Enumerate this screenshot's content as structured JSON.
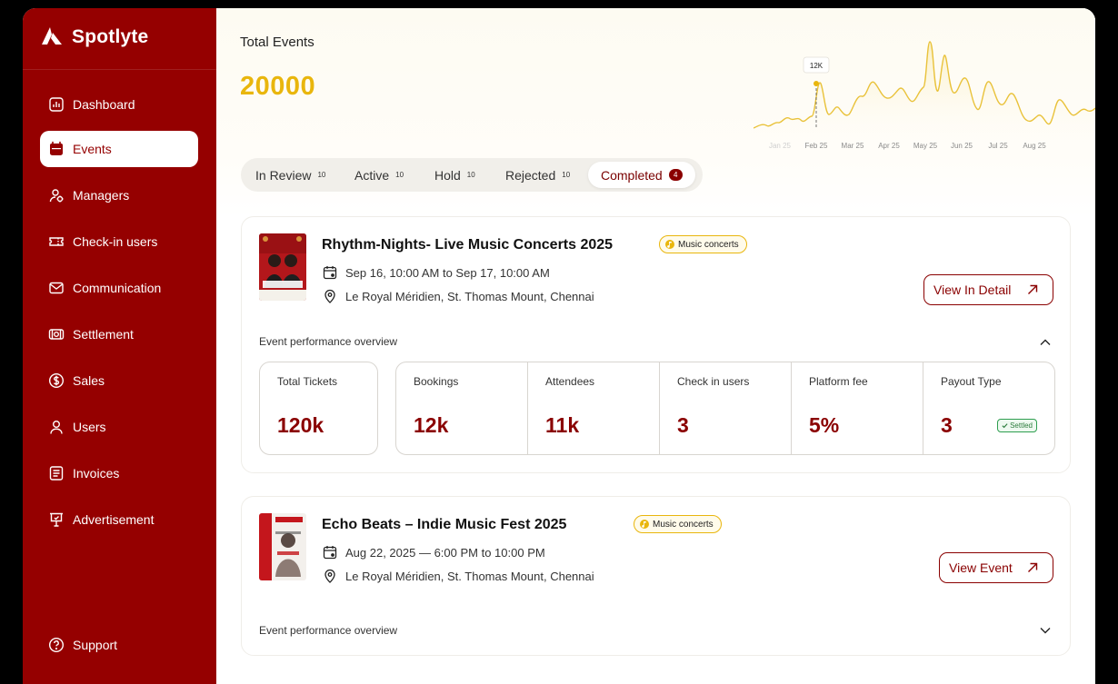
{
  "brand": {
    "name": "Spotlyte"
  },
  "sidebar": {
    "items": [
      {
        "label": "Dashboard",
        "icon": "chart-icon"
      },
      {
        "label": "Events",
        "icon": "calendar-icon",
        "active": true
      },
      {
        "label": "Managers",
        "icon": "managers-icon"
      },
      {
        "label": "Check-in users",
        "icon": "ticket-icon"
      },
      {
        "label": "Communication",
        "icon": "mail-icon"
      },
      {
        "label": "Settlement",
        "icon": "money-icon"
      },
      {
        "label": "Sales",
        "icon": "dollar-icon"
      },
      {
        "label": "Users",
        "icon": "user-icon"
      },
      {
        "label": "Invoices",
        "icon": "invoice-icon"
      },
      {
        "label": "Advertisement",
        "icon": "billboard-icon"
      }
    ],
    "support": "Support"
  },
  "summary": {
    "label": "Total Events",
    "value": "20000",
    "chart_tooltip": "12K",
    "months": [
      "Jan 25",
      "Feb 25",
      "Mar 25",
      "Apr 25",
      "May 25",
      "Jun 25",
      "Jul 25",
      "Aug 25"
    ]
  },
  "tabs": [
    {
      "label": "In Review",
      "count": "10"
    },
    {
      "label": "Active",
      "count": "10"
    },
    {
      "label": "Hold",
      "count": "10"
    },
    {
      "label": "Rejected",
      "count": "10"
    },
    {
      "label": "Completed",
      "count": "4",
      "active": true
    }
  ],
  "events": [
    {
      "title": "Rhythm-Nights- Live Music Concerts 2025",
      "category": "Music concerts",
      "datetime": "Sep 16, 10:00 AM to Sep 17, 10:00 AM",
      "venue": "Le Royal Méridien, St. Thomas Mount, Chennai",
      "button": "View In Detail",
      "perf_label": "Event performance overview",
      "stats": {
        "total_tickets": {
          "label": "Total Tickets",
          "value": "120k"
        },
        "bookings": {
          "label": "Bookings",
          "value": "12k"
        },
        "attendees": {
          "label": "Attendees",
          "value": "11k"
        },
        "checkin": {
          "label": "Check in users",
          "value": "3"
        },
        "platform_fee": {
          "label": "Platform fee",
          "value": "5%"
        },
        "payout": {
          "label": "Payout Type",
          "value": "3",
          "status": "Settled"
        }
      }
    },
    {
      "title": "Echo Beats – Indie Music Fest 2025",
      "category": "Music concerts",
      "datetime": "Aug 22, 2025 — 6:00 PM to 10:00 PM",
      "venue": "Le Royal Méridien, St. Thomas Mount, Chennai",
      "button": "View Event",
      "perf_label": "Event performance overview"
    }
  ],
  "colors": {
    "primary": "#950000",
    "accent": "#e9b60d",
    "success": "#2e9e4f"
  }
}
